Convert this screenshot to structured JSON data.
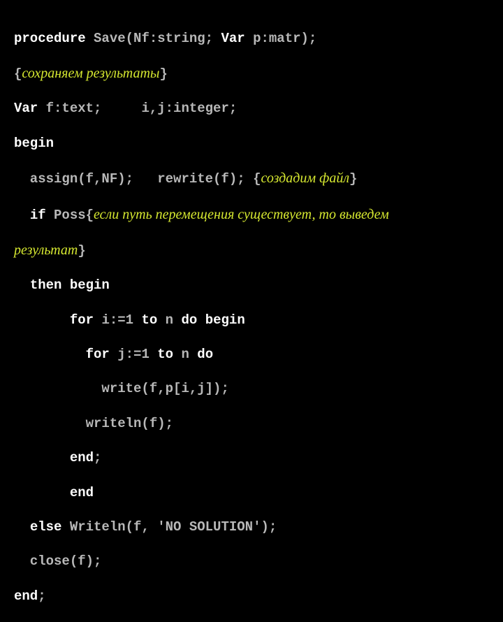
{
  "code": {
    "l1_kw1": "procedure",
    "l1_pl1": " Save(Nf:string; ",
    "l1_kw2": "Var",
    "l1_pl2": " p:matr);",
    "l2_brace_open": "{",
    "l2_cm": "сохраняем результаты",
    "l2_brace_close": "}",
    "l3_kw": "Var",
    "l3_pl": " f:text;     i,j:integer;",
    "l4_kw": "begin",
    "l5_pl1": "  assign(f,NF);   rewrite(f); ",
    "l5_brace_open": "{",
    "l5_cm": "создадим файл",
    "l5_brace_close": "}",
    "l6_kw": "if",
    "l6_pl": " Poss",
    "l6_brace_open": "{",
    "l6_cm1": "если путь перемещения существует, то выведем",
    "l7_cm": "результат",
    "l7_brace_close": "}",
    "l8_pre": "  ",
    "l8_kw1": "then",
    "l8_sp": " ",
    "l8_kw2": "begin",
    "l9_pre": "       ",
    "l9_kw1": "for",
    "l9_pl1": " i:=1 ",
    "l9_kw2": "to",
    "l9_pl2": " n ",
    "l9_kw3": "do",
    "l9_sp": " ",
    "l9_kw4": "begin",
    "l10_pre": "         ",
    "l10_kw1": "for",
    "l10_pl1": " j:=1 ",
    "l10_kw2": "to",
    "l10_pl2": " n ",
    "l10_kw3": "do",
    "l11_pl": "           write(f,p[i,j]);",
    "l12_pl": "         writeln(f);",
    "l13_pre": "       ",
    "l13_kw": "end",
    "l13_pl": ";",
    "l14_pre": "       ",
    "l14_kw": "end",
    "l15_pre": "  ",
    "l15_kw": "else",
    "l15_pl": " Writeln(f, 'NO SOLUTION');",
    "l16_pl": "  close(f);",
    "l17_kw": "end",
    "l17_pl": ";"
  }
}
